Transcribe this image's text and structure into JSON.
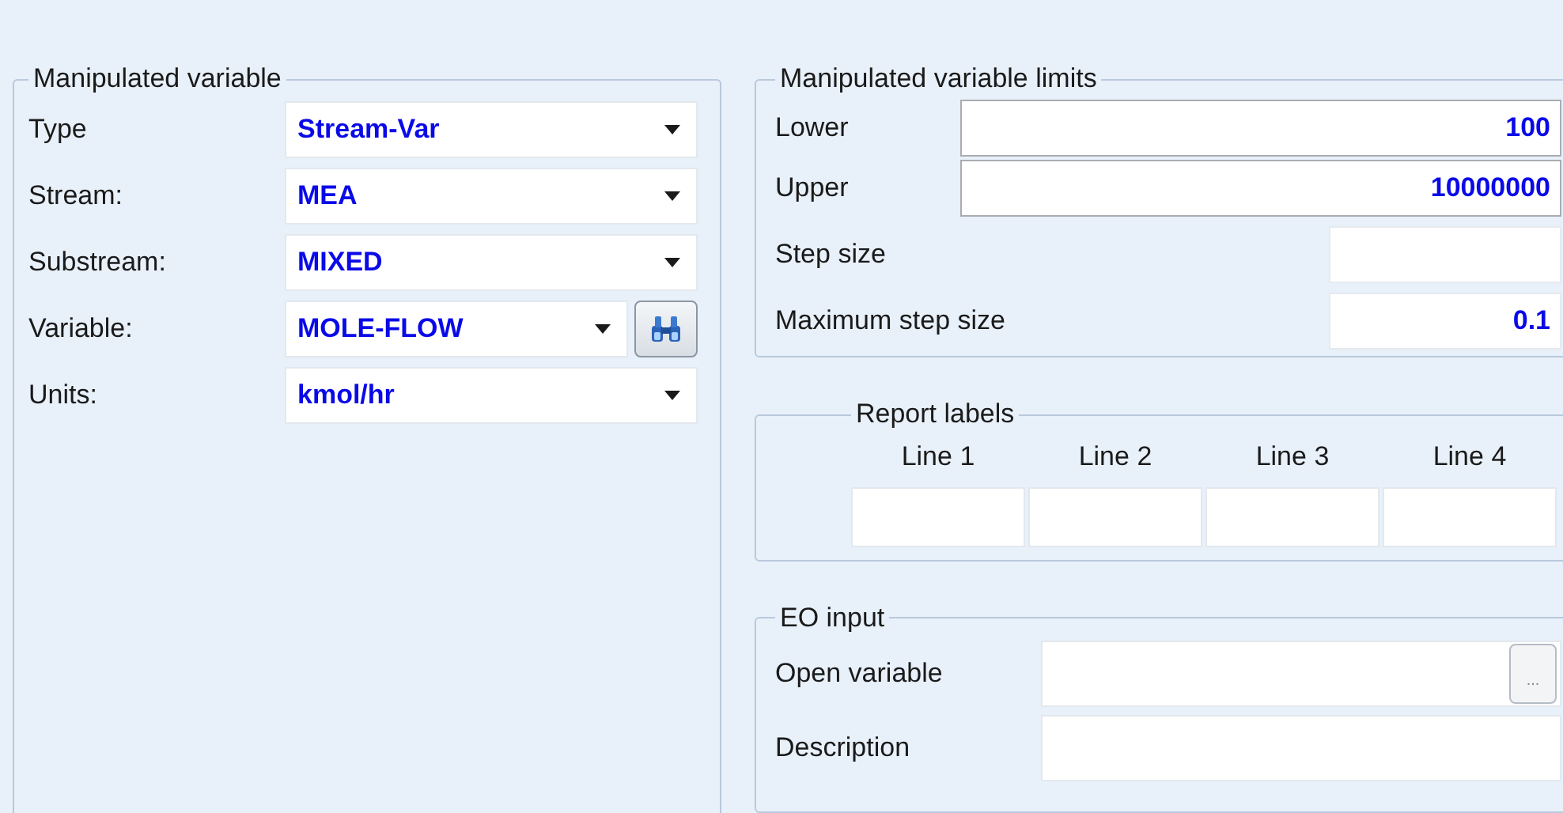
{
  "manipulated_variable": {
    "title": "Manipulated variable",
    "rows": [
      {
        "label": "Type",
        "value": "Stream-Var",
        "has_search": false
      },
      {
        "label": "Stream:",
        "value": "MEA",
        "has_search": false
      },
      {
        "label": "Substream:",
        "value": "MIXED",
        "has_search": false
      },
      {
        "label": "Variable:",
        "value": "MOLE-FLOW",
        "has_search": true
      },
      {
        "label": "Units:",
        "value": "kmol/hr",
        "has_search": false
      }
    ]
  },
  "limits": {
    "title": "Manipulated variable limits",
    "rows": [
      {
        "label": "Lower",
        "value": "100",
        "kind": "wide"
      },
      {
        "label": "Upper",
        "value": "10000000",
        "kind": "wide"
      },
      {
        "label": "Step size",
        "kind": "short"
      },
      {
        "label": "Maximum step size",
        "value": "0.1",
        "kind": "short"
      }
    ]
  },
  "report_labels": {
    "title": "Report labels",
    "columns": [
      "Line 1",
      "Line 2",
      "Line 3",
      "Line 4"
    ]
  },
  "eo_input": {
    "title": "EO input",
    "rows": [
      {
        "label": "Open variable",
        "button": "..."
      },
      {
        "label": "Description"
      }
    ]
  }
}
